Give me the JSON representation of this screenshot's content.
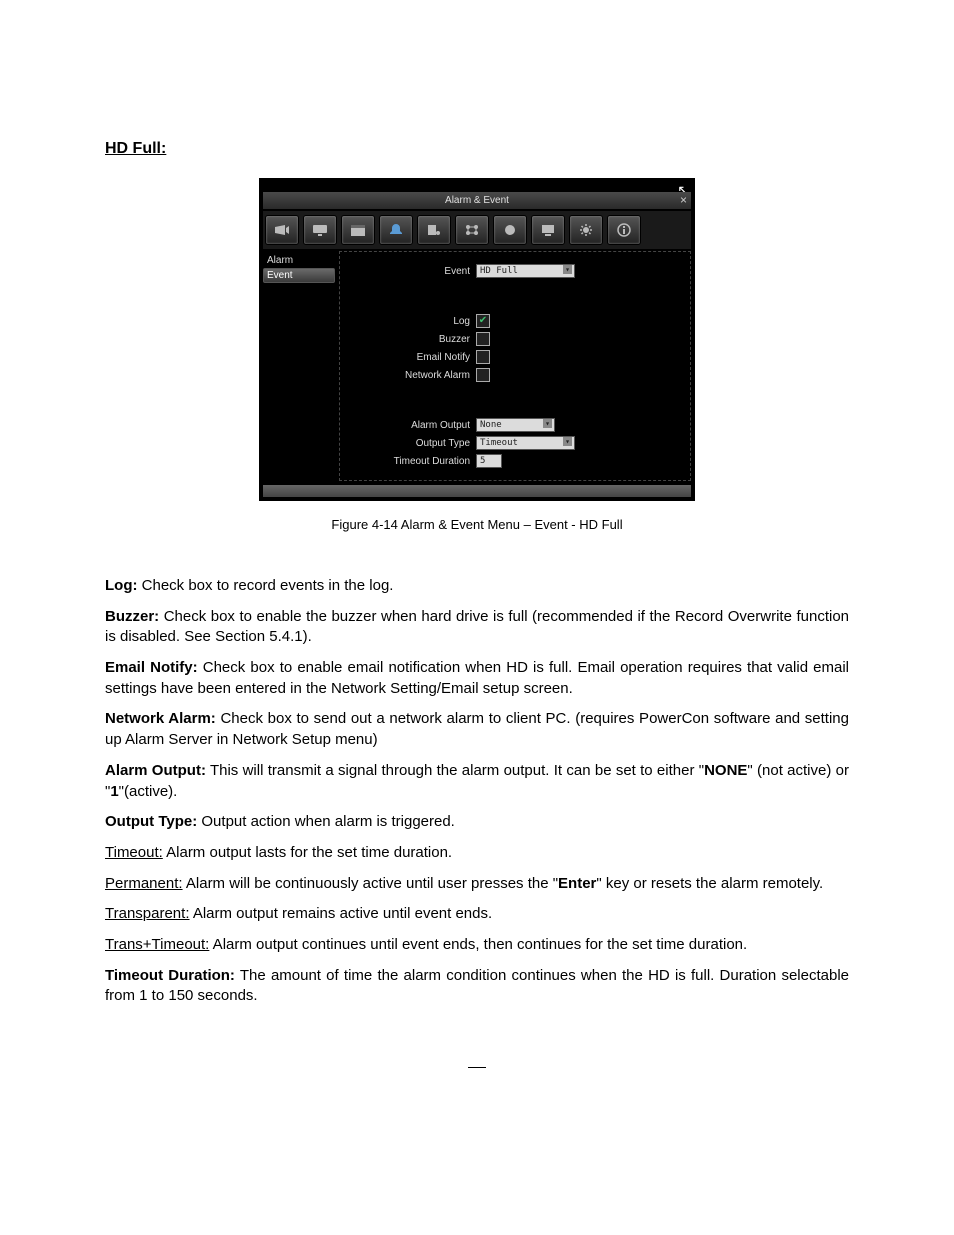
{
  "heading": "HD Full:",
  "dvr": {
    "title": "Alarm & Event",
    "sidebar": {
      "items": [
        "Alarm",
        "Event"
      ],
      "selected_index": 1
    },
    "toolbar_icons": [
      "camera-icon",
      "monitor-icon",
      "schedule-icon",
      "alarm-bell-icon",
      "event-icon",
      "network-icon",
      "record-icon",
      "display-icon",
      "system-icon",
      "info-icon"
    ],
    "fields": {
      "event": {
        "label": "Event",
        "value": "HD Full"
      },
      "log": {
        "label": "Log",
        "checked": true
      },
      "buzzer": {
        "label": "Buzzer",
        "checked": false
      },
      "email_notify": {
        "label": "Email Notify",
        "checked": false
      },
      "network_alarm": {
        "label": "Network Alarm",
        "checked": false
      },
      "alarm_output": {
        "label": "Alarm Output",
        "value": "None"
      },
      "output_type": {
        "label": "Output Type",
        "value": "Timeout"
      },
      "timeout_duration": {
        "label": "Timeout Duration",
        "value": "5"
      }
    }
  },
  "figure_caption": "Figure 4-14   Alarm & Event Menu – Event - HD Full",
  "paragraphs": {
    "log": {
      "label": "Log:",
      "text": " Check box to record events in the log."
    },
    "buzzer": {
      "label": "Buzzer:",
      "text": " Check box to enable the buzzer when hard drive is full (recommended if the Record Overwrite function is disabled. See Section 5.4.1)."
    },
    "email": {
      "label": "Email Notify:",
      "text": " Check box to enable email notification when HD is full.  Email operation requires that valid email settings have been entered in the Network Setting/Email setup screen."
    },
    "network": {
      "label": "Network Alarm:",
      "text": " Check box to send out a network alarm to client PC. (requires PowerCon software and setting up Alarm Server in Network Setup menu)"
    },
    "alarm_output": {
      "label": "Alarm Output:",
      "pre": " This will transmit a signal through the alarm output. It can be set to either \"",
      "bold1": "NONE",
      "mid": "\" (not active) or \"",
      "bold2": "1",
      "post": "\"(active)."
    },
    "output_type": {
      "label": "Output Type:",
      "text": " Output action when alarm is triggered."
    },
    "timeout_item": {
      "label": "Timeout:",
      "text": " Alarm output lasts for the set time duration."
    },
    "permanent_item": {
      "label": "Permanent:",
      "pre": " Alarm will be continuously active until user presses the \"",
      "bold1": "Enter",
      "post": "\" key or resets the alarm remotely."
    },
    "transparent_item": {
      "label": "Transparent:",
      "text": " Alarm output remains active until event ends."
    },
    "trans_timeout_item": {
      "label": "Trans+Timeout:",
      "text": " Alarm output continues until event ends, then continues for the set time duration."
    },
    "timeout_duration": {
      "label": "Timeout Duration:",
      "text": " The amount of time the alarm condition continues when the HD is full. Duration selectable from 1 to 150 seconds."
    }
  }
}
